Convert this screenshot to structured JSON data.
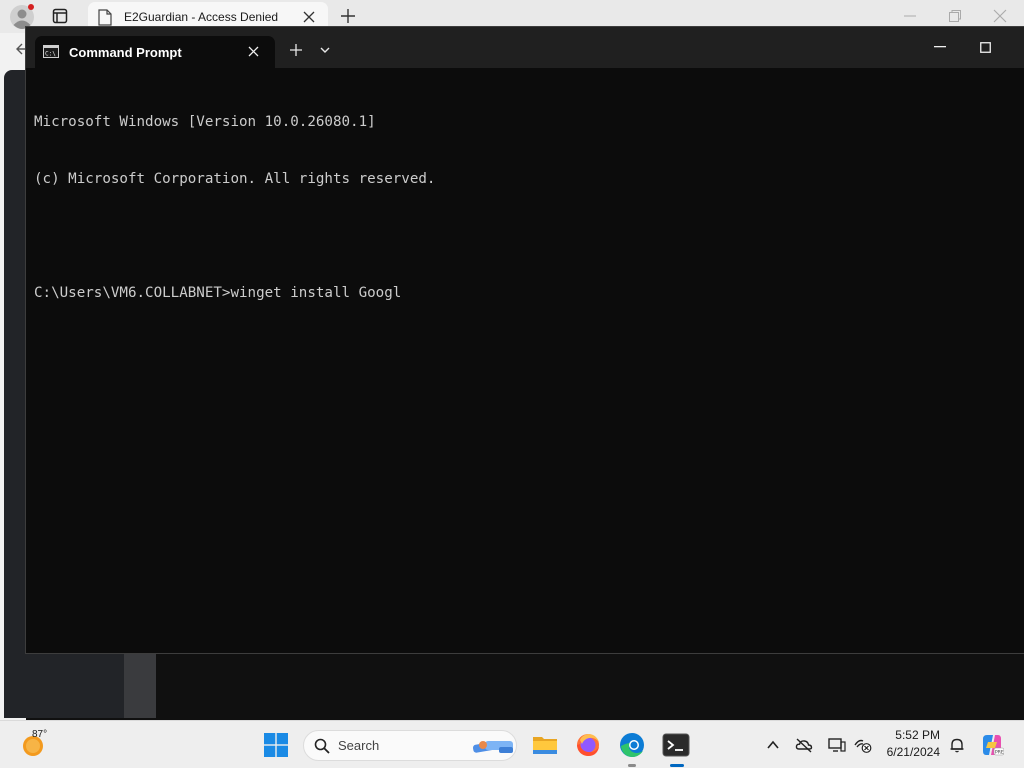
{
  "browser": {
    "tab_title": "E2Guardian - Access Denied"
  },
  "terminal": {
    "tab_title": "Command Prompt",
    "lines": [
      "Microsoft Windows [Version 10.0.26080.1]",
      "(c) Microsoft Corporation. All rights reserved.",
      "",
      "C:\\Users\\VM6.COLLABNET>winget install Googl"
    ]
  },
  "taskbar": {
    "weather_temp": "87°",
    "search_placeholder": "Search",
    "clock_time": "5:52 PM",
    "clock_date": "6/21/2024",
    "pinned_apps": [
      "file-explorer",
      "firefox",
      "edge",
      "terminal"
    ]
  },
  "colors": {
    "terminal_bg": "#0c0c0c",
    "terminal_text": "#cccccc",
    "accent": "#0067c0"
  }
}
